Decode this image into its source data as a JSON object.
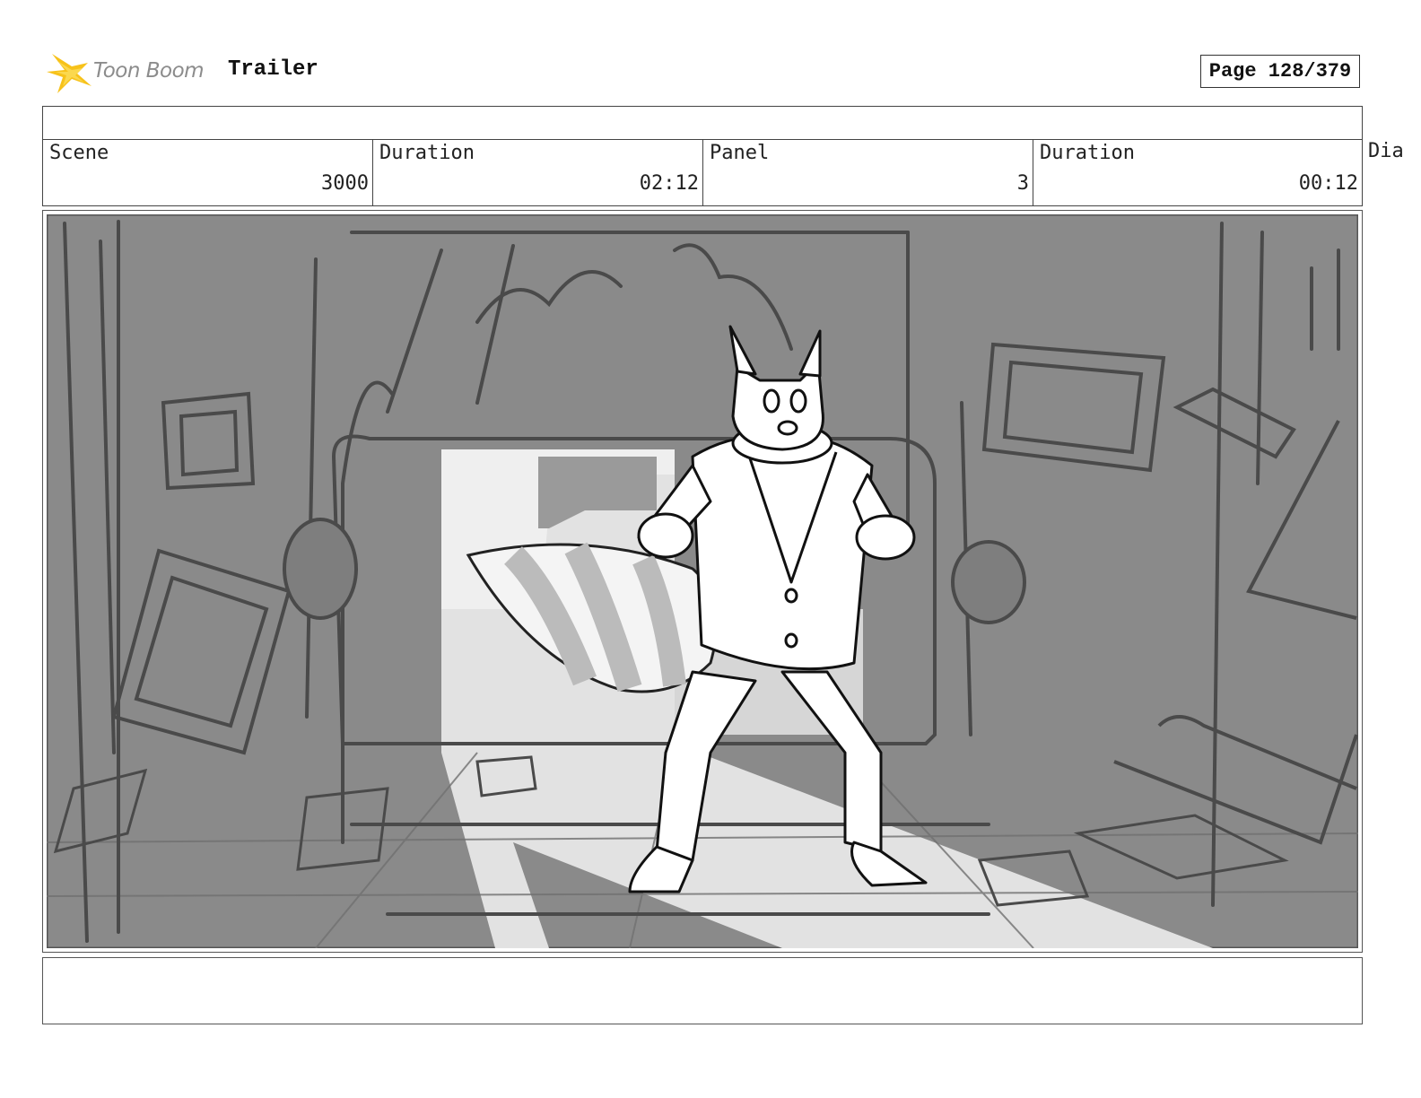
{
  "header": {
    "logo_text": "Toon Boom",
    "project_title": "Trailer",
    "page_label": "Page 128/379"
  },
  "info": {
    "scene_label": "Scene",
    "scene_value": "3000",
    "scene_duration_label": "Duration",
    "scene_duration_value": "02:12",
    "panel_label": "Panel",
    "panel_value": "3",
    "panel_duration_label": "Duration",
    "panel_duration_value": "00:12",
    "dialogue_label": "Dia"
  },
  "colors": {
    "logo_accent": "#f7c21a",
    "sketch_background": "#8a8a8a",
    "light_beam": "#e6e6e6"
  }
}
